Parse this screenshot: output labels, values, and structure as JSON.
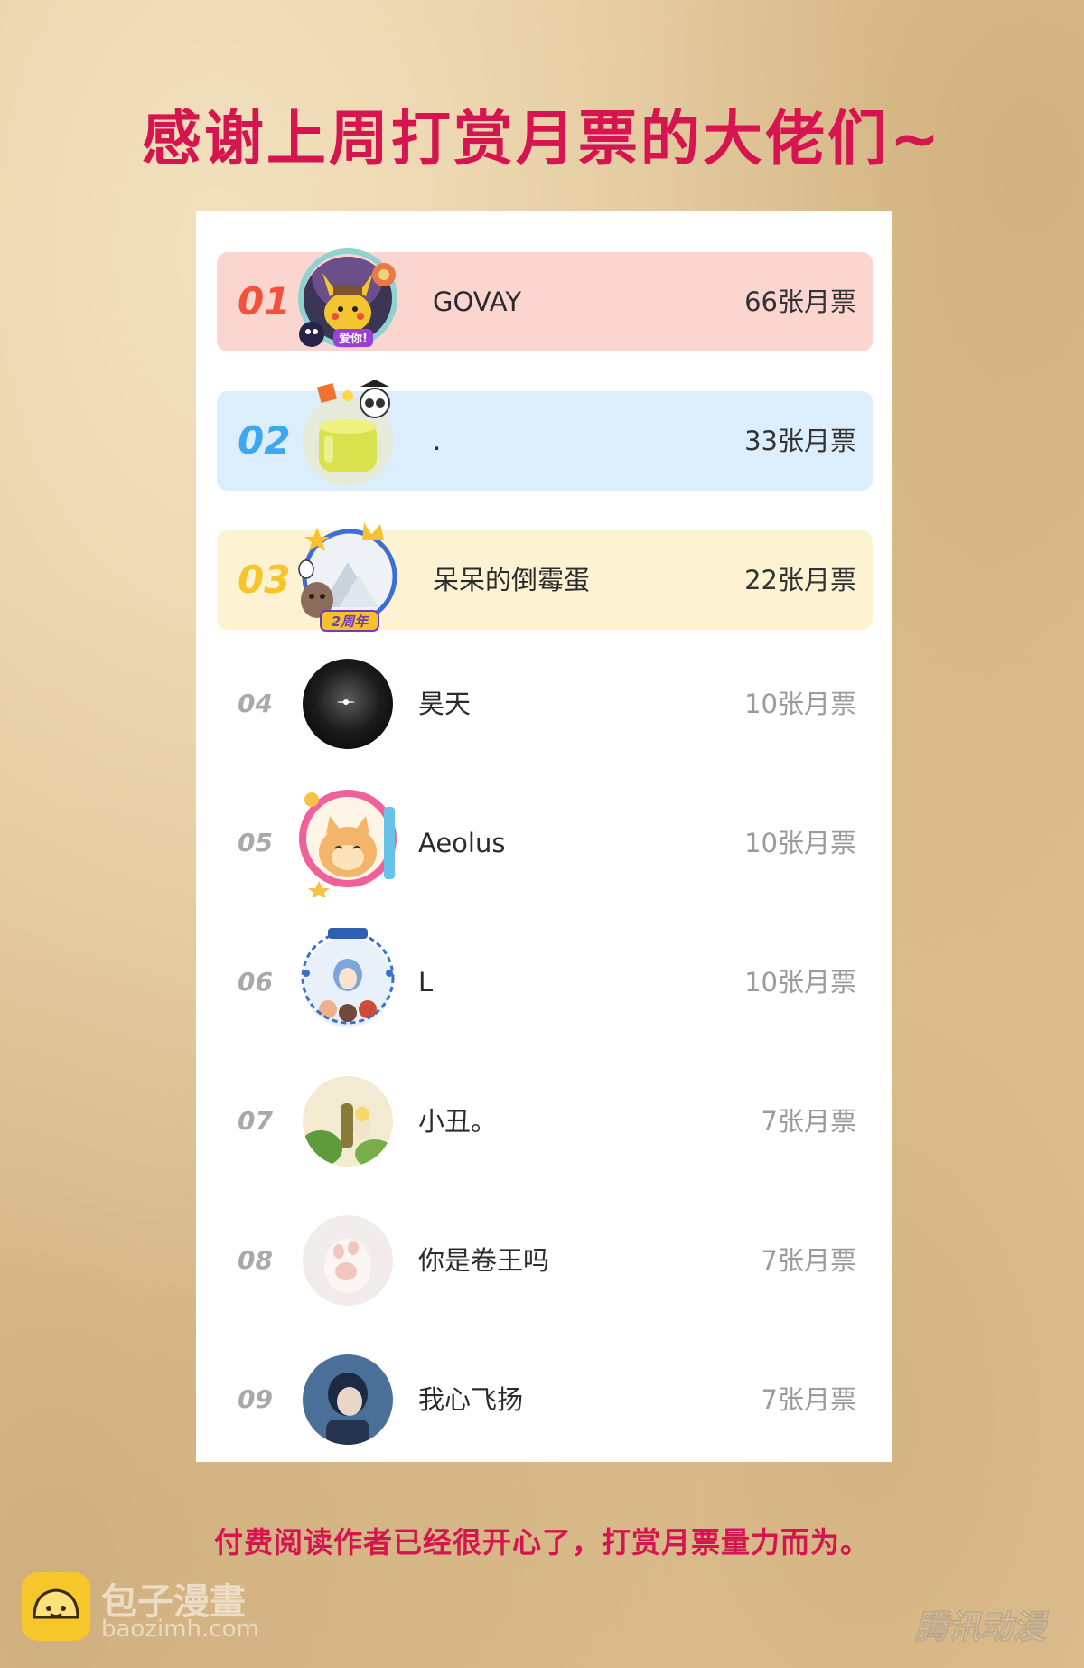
{
  "title": "感谢上周打赏月票的大佬们~",
  "ranking": [
    {
      "rank": "01",
      "name": "GOVAY",
      "votes": "66张月票",
      "avatar": "pikachu-detective-avatar",
      "frame": "cat-bell-frame",
      "badge": "爱你!"
    },
    {
      "rank": "02",
      "name": ".",
      "votes": "33张月票",
      "avatar": "yellow-jelly-avatar",
      "frame": "owl-graduate-frame",
      "badge": ""
    },
    {
      "rank": "03",
      "name": "呆呆的倒霉蛋",
      "votes": "22张月票",
      "avatar": "crown-cat-avatar",
      "frame": "crown-star-frame",
      "badge": "2周年"
    },
    {
      "rank": "04",
      "name": "昊天",
      "votes": "10张月票",
      "avatar": "dark-sphere-avatar",
      "frame": "",
      "badge": ""
    },
    {
      "rank": "05",
      "name": "Aeolus",
      "votes": "10张月票",
      "avatar": "fat-cat-avatar",
      "frame": "pink-ring-frame",
      "badge": ""
    },
    {
      "rank": "06",
      "name": "L",
      "votes": "10张月票",
      "avatar": "anime-group-avatar",
      "frame": "blue-badge-frame",
      "badge": ""
    },
    {
      "rank": "07",
      "name": "小丑。",
      "votes": "7张月票",
      "avatar": "jungle-scene-avatar",
      "frame": "",
      "badge": ""
    },
    {
      "rank": "08",
      "name": "你是卷王吗",
      "votes": "7张月票",
      "avatar": "cat-paw-avatar",
      "frame": "",
      "badge": ""
    },
    {
      "rank": "09",
      "name": "我心飞扬",
      "votes": "7张月票",
      "avatar": "anime-boy-avatar",
      "frame": "",
      "badge": ""
    }
  ],
  "footer_note": "付费阅读作者已经很开心了，打赏月票量力而为。",
  "watermark": {
    "brand": "包子漫畫",
    "domain": "baozimh.com",
    "corner_logo": "腾讯动漫"
  },
  "colors": {
    "title": "#d6144f",
    "rank1_bg": "#fbd5d0",
    "rank1_num": "#f2513b",
    "rank2_bg": "#dcedfc",
    "rank2_num": "#3ea7f2",
    "rank3_bg": "#fdf3d2",
    "rank3_num": "#f7c52a"
  }
}
